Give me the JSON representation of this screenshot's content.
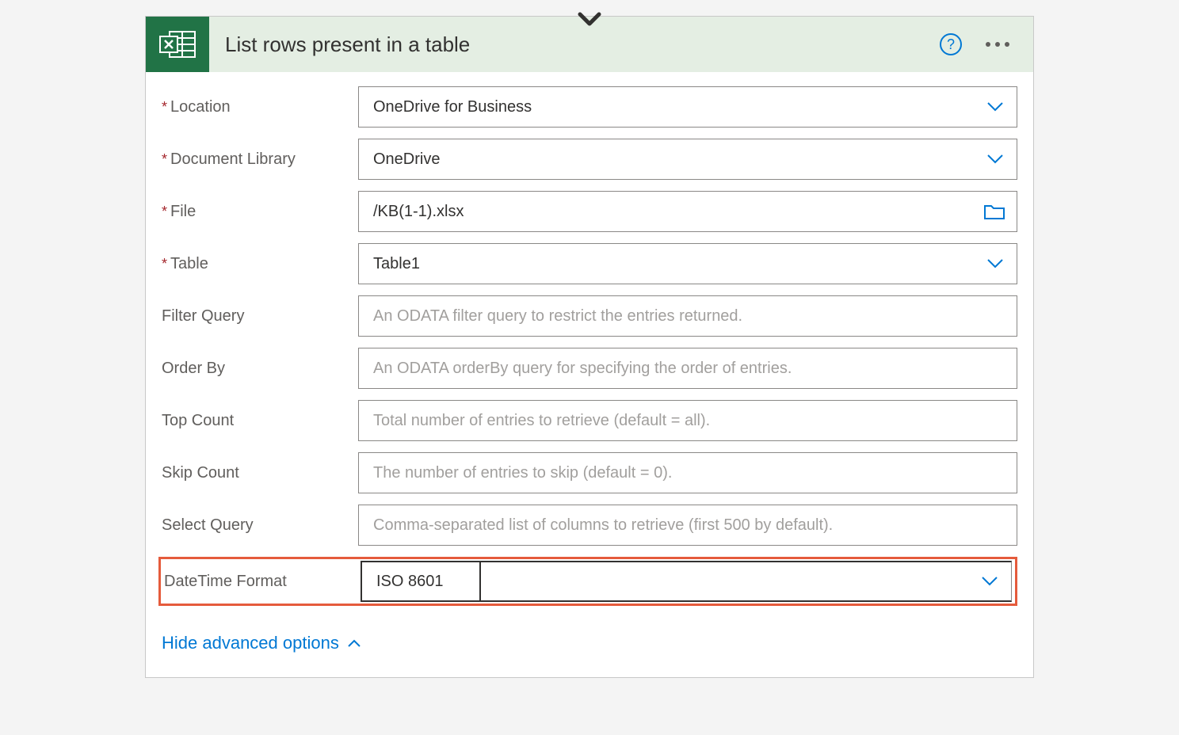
{
  "header": {
    "title": "List rows present in a table"
  },
  "fields": {
    "location": {
      "label": "Location",
      "value": "OneDrive for Business"
    },
    "documentLibrary": {
      "label": "Document Library",
      "value": "OneDrive"
    },
    "file": {
      "label": "File",
      "value": "/KB(1-1).xlsx"
    },
    "table": {
      "label": "Table",
      "value": "Table1"
    },
    "filterQuery": {
      "label": "Filter Query",
      "placeholder": "An ODATA filter query to restrict the entries returned."
    },
    "orderBy": {
      "label": "Order By",
      "placeholder": "An ODATA orderBy query for specifying the order of entries."
    },
    "topCount": {
      "label": "Top Count",
      "placeholder": "Total number of entries to retrieve (default = all)."
    },
    "skipCount": {
      "label": "Skip Count",
      "placeholder": "The number of entries to skip (default = 0)."
    },
    "selectQuery": {
      "label": "Select Query",
      "placeholder": "Comma-separated list of columns to retrieve (first 500 by default)."
    },
    "dateTimeFormat": {
      "label": "DateTime Format",
      "value": "ISO 8601"
    }
  },
  "advancedToggle": "Hide advanced options"
}
